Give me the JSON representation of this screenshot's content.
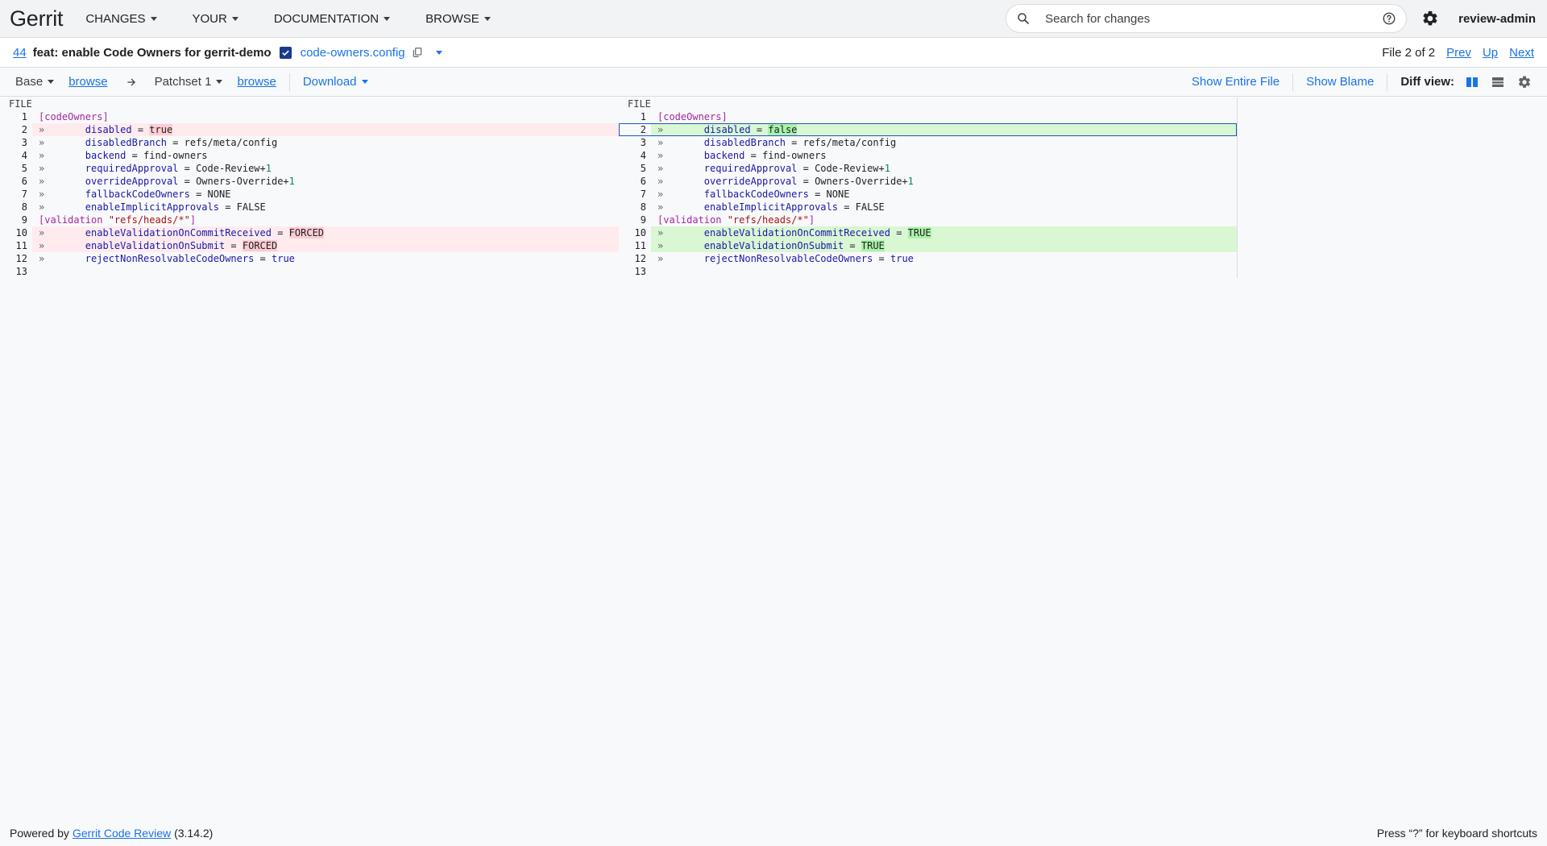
{
  "header": {
    "brand": "Gerrit",
    "menus": [
      "CHANGES",
      "YOUR",
      "DOCUMENTATION",
      "BROWSE"
    ],
    "search_placeholder": "Search for changes",
    "user": "review-admin"
  },
  "subheader": {
    "change_number": "44",
    "change_subject": "feat: enable Code Owners for gerrit-demo",
    "file_name": "code-owners.config",
    "file_position": "File 2 of 2",
    "prev": "Prev",
    "up": "Up",
    "next": "Next"
  },
  "toolbar": {
    "base": "Base",
    "browse_left": "browse",
    "patchset": "Patchset 1",
    "browse_right": "browse",
    "download": "Download",
    "show_entire_file": "Show Entire File",
    "show_blame": "Show Blame",
    "diff_view_label": "Diff view:"
  },
  "diff": {
    "file_label_left": "FILE",
    "file_label_right": "FILE",
    "left": [
      {
        "n": "1",
        "type": "ctx",
        "parts": [
          [
            "sec",
            "[codeOwners]"
          ]
        ]
      },
      {
        "n": "2",
        "type": "rem",
        "parts": [
          [
            "tab",
            "»       "
          ],
          [
            "k",
            "disabled"
          ],
          [
            "val",
            " = "
          ],
          [
            "hl-rem",
            "true"
          ]
        ]
      },
      {
        "n": "3",
        "type": "ctx",
        "parts": [
          [
            "tab",
            "»       "
          ],
          [
            "k",
            "disabledBranch"
          ],
          [
            "val",
            " = refs/meta/config"
          ]
        ]
      },
      {
        "n": "4",
        "type": "ctx",
        "parts": [
          [
            "tab",
            "»       "
          ],
          [
            "k",
            "backend"
          ],
          [
            "val",
            " = find-owners"
          ]
        ]
      },
      {
        "n": "5",
        "type": "ctx",
        "parts": [
          [
            "tab",
            "»       "
          ],
          [
            "k",
            "requiredApproval"
          ],
          [
            "val",
            " = Code-Review+"
          ],
          [
            "num",
            "1"
          ]
        ]
      },
      {
        "n": "6",
        "type": "ctx",
        "parts": [
          [
            "tab",
            "»       "
          ],
          [
            "k",
            "overrideApproval"
          ],
          [
            "val",
            " = Owners-Override+"
          ],
          [
            "num",
            "1"
          ]
        ]
      },
      {
        "n": "7",
        "type": "ctx",
        "parts": [
          [
            "tab",
            "»       "
          ],
          [
            "k",
            "fallbackCodeOwners"
          ],
          [
            "val",
            " = NONE"
          ]
        ]
      },
      {
        "n": "8",
        "type": "ctx",
        "parts": [
          [
            "tab",
            "»       "
          ],
          [
            "k",
            "enableImplicitApprovals"
          ],
          [
            "val",
            " = FALSE"
          ]
        ]
      },
      {
        "n": "9",
        "type": "ctx",
        "parts": [
          [
            "sec",
            "[validation "
          ],
          [
            "str",
            "\"refs/heads/*\""
          ],
          [
            "sec",
            "]"
          ]
        ]
      },
      {
        "n": "10",
        "type": "rem",
        "parts": [
          [
            "tab",
            "»       "
          ],
          [
            "k",
            "enableValidationOnCommitReceived"
          ],
          [
            "val",
            " = "
          ],
          [
            "hl-rem",
            "FORCED"
          ]
        ]
      },
      {
        "n": "11",
        "type": "rem",
        "parts": [
          [
            "tab",
            "»       "
          ],
          [
            "k",
            "enableValidationOnSubmit"
          ],
          [
            "val",
            " = "
          ],
          [
            "hl-rem",
            "FORCED"
          ]
        ]
      },
      {
        "n": "12",
        "type": "ctx",
        "parts": [
          [
            "tab",
            "»       "
          ],
          [
            "k",
            "rejectNonResolvableCodeOwners"
          ],
          [
            "val",
            " = "
          ],
          [
            "k",
            "true"
          ]
        ]
      },
      {
        "n": "13",
        "type": "ctx",
        "parts": []
      }
    ],
    "right": [
      {
        "n": "1",
        "type": "ctx",
        "parts": [
          [
            "sec",
            "[codeOwners]"
          ]
        ]
      },
      {
        "n": "2",
        "type": "add",
        "selected": true,
        "parts": [
          [
            "tab",
            "»       "
          ],
          [
            "k",
            "disabled"
          ],
          [
            "val",
            " = "
          ],
          [
            "hl-add",
            "false"
          ]
        ]
      },
      {
        "n": "3",
        "type": "ctx",
        "parts": [
          [
            "tab",
            "»       "
          ],
          [
            "k",
            "disabledBranch"
          ],
          [
            "val",
            " = refs/meta/config"
          ]
        ]
      },
      {
        "n": "4",
        "type": "ctx",
        "parts": [
          [
            "tab",
            "»       "
          ],
          [
            "k",
            "backend"
          ],
          [
            "val",
            " = find-owners"
          ]
        ]
      },
      {
        "n": "5",
        "type": "ctx",
        "parts": [
          [
            "tab",
            "»       "
          ],
          [
            "k",
            "requiredApproval"
          ],
          [
            "val",
            " = Code-Review+"
          ],
          [
            "num",
            "1"
          ]
        ]
      },
      {
        "n": "6",
        "type": "ctx",
        "parts": [
          [
            "tab",
            "»       "
          ],
          [
            "k",
            "overrideApproval"
          ],
          [
            "val",
            " = Owners-Override+"
          ],
          [
            "num",
            "1"
          ]
        ]
      },
      {
        "n": "7",
        "type": "ctx",
        "parts": [
          [
            "tab",
            "»       "
          ],
          [
            "k",
            "fallbackCodeOwners"
          ],
          [
            "val",
            " = NONE"
          ]
        ]
      },
      {
        "n": "8",
        "type": "ctx",
        "parts": [
          [
            "tab",
            "»       "
          ],
          [
            "k",
            "enableImplicitApprovals"
          ],
          [
            "val",
            " = FALSE"
          ]
        ]
      },
      {
        "n": "9",
        "type": "ctx",
        "parts": [
          [
            "sec",
            "[validation "
          ],
          [
            "str",
            "\"refs/heads/*\""
          ],
          [
            "sec",
            "]"
          ]
        ]
      },
      {
        "n": "10",
        "type": "add",
        "parts": [
          [
            "tab",
            "»       "
          ],
          [
            "k",
            "enableValidationOnCommitReceived"
          ],
          [
            "val",
            " = "
          ],
          [
            "hl-add",
            "TRUE"
          ]
        ]
      },
      {
        "n": "11",
        "type": "add",
        "parts": [
          [
            "tab",
            "»       "
          ],
          [
            "k",
            "enableValidationOnSubmit"
          ],
          [
            "val",
            " = "
          ],
          [
            "hl-add",
            "TRUE"
          ]
        ]
      },
      {
        "n": "12",
        "type": "ctx",
        "parts": [
          [
            "tab",
            "»       "
          ],
          [
            "k",
            "rejectNonResolvableCodeOwners"
          ],
          [
            "val",
            " = "
          ],
          [
            "k",
            "true"
          ]
        ]
      },
      {
        "n": "13",
        "type": "ctx",
        "parts": []
      }
    ]
  },
  "footer": {
    "powered_by": "Powered by",
    "product_link": "Gerrit Code Review",
    "version": "(3.14.2)",
    "shortcuts_hint": "Press “?” for keyboard shortcuts"
  }
}
